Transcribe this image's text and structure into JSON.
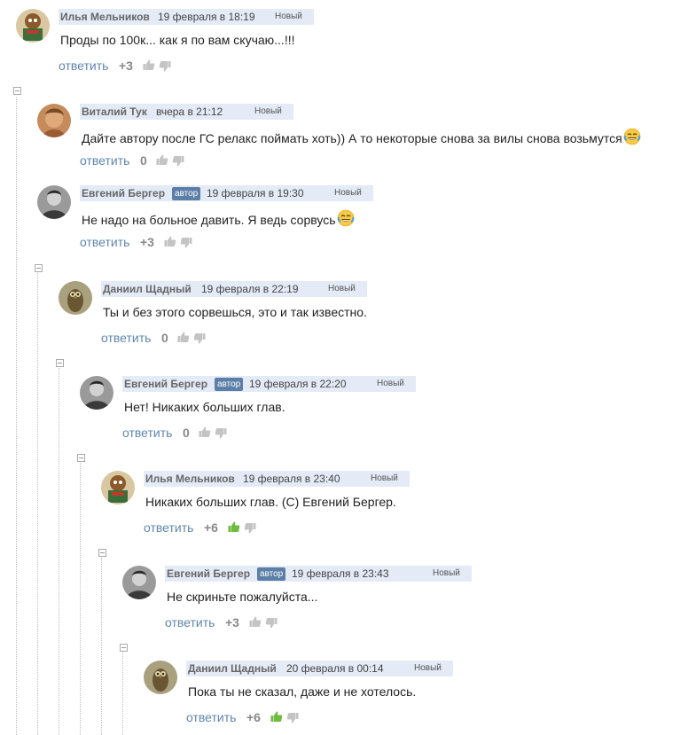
{
  "labels": {
    "reply": "ответить",
    "author_badge": "автор",
    "new_badge": "Новый"
  },
  "colors": {
    "header_bg": "#e4eaf6",
    "author_badge_bg": "#5b7fa6",
    "reply_link": "#5f86ad",
    "thumb_up_active": "#6dbb3f"
  },
  "comments": [
    {
      "author": "Илья Мельников",
      "date": "19 февраля в 18:19",
      "text": "Проды по 100к... как я по вам скучаю...!!!",
      "score": "+3",
      "is_author": false,
      "upvoted": false,
      "avatar": "cartoon-avatar",
      "emoji": null
    },
    {
      "author": "Виталий Тук",
      "date": "вчера в 21:12",
      "text": "Дайте автору после ГС релакс поймать хоть)) А то некоторые снова за вилы снова возьмутся",
      "score": "0",
      "is_author": false,
      "upvoted": false,
      "avatar": "photo-avatar",
      "emoji": "laughing-crying-emoji"
    },
    {
      "author": "Евгений Бергер",
      "date": "19 февраля в 19:30",
      "text": "Не надо на больное давить. Я ведь сорвусь",
      "score": "+3",
      "is_author": true,
      "upvoted": false,
      "avatar": "bw-photo-avatar",
      "emoji": "laughing-crying-emoji"
    },
    {
      "author": "Даниил Щадный",
      "date": "19 февраля в 22:19",
      "text": "Ты и без этого сорвешься, это и так известно.",
      "score": "0",
      "is_author": false,
      "upvoted": false,
      "avatar": "owl-avatar",
      "emoji": null
    },
    {
      "author": "Евгений Бергер",
      "date": "19 февраля в 22:20",
      "text": "Нет! Никаких больших глав.",
      "score": "0",
      "is_author": true,
      "upvoted": false,
      "avatar": "bw-photo-avatar",
      "emoji": null
    },
    {
      "author": "Илья Мельников",
      "date": "19 февраля в 23:40",
      "text": "Никаких больших глав. (С) Евгений Бергер.",
      "score": "+6",
      "is_author": false,
      "upvoted": true,
      "avatar": "cartoon-avatar",
      "emoji": null
    },
    {
      "author": "Евгений Бергер",
      "date": "19 февраля в 23:43",
      "text": "Не скриньте пожалуйста...",
      "score": "+3",
      "is_author": true,
      "upvoted": false,
      "avatar": "bw-photo-avatar",
      "emoji": null
    },
    {
      "author": "Даниил Щадный",
      "date": "20 февраля в 00:14",
      "text": "Пока ты не сказал, даже и не хотелось.",
      "score": "+6",
      "is_author": false,
      "upvoted": true,
      "avatar": "owl-avatar",
      "emoji": null
    }
  ]
}
